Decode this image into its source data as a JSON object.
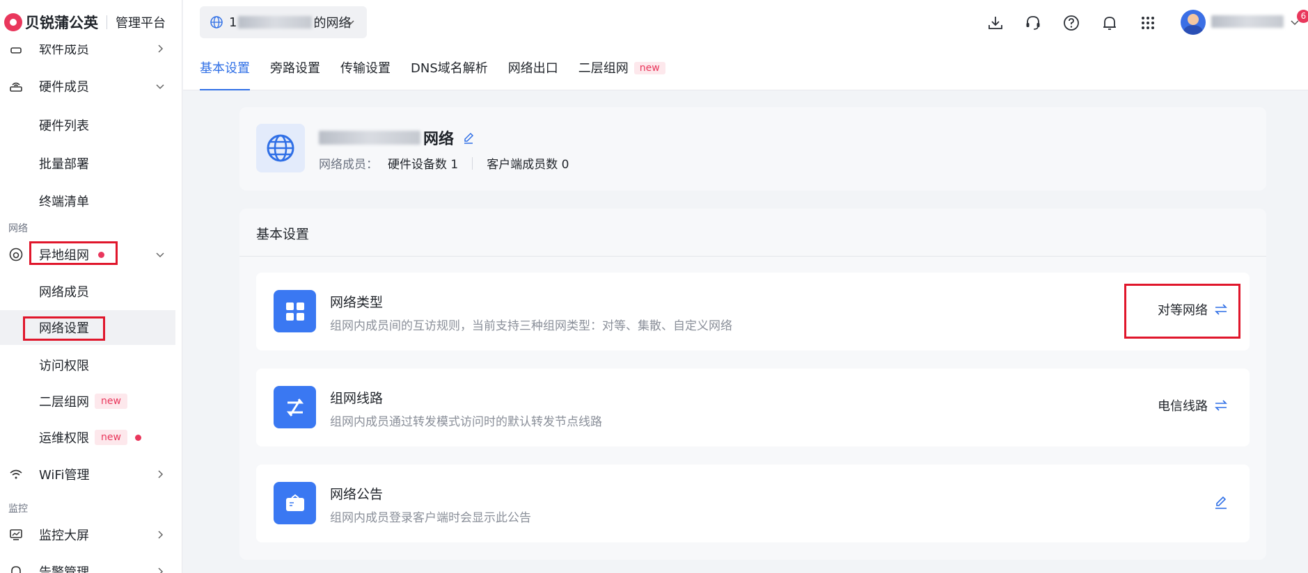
{
  "brand": {
    "name": "贝锐蒲公英",
    "subtitle": "管理平台"
  },
  "sidebar": {
    "items": [
      {
        "label": "软件成员",
        "icon": "device-icon"
      },
      {
        "label": "硬件成员",
        "icon": "router-icon"
      },
      {
        "label": "硬件列表"
      },
      {
        "label": "批量部署"
      },
      {
        "label": "终端清单"
      },
      {
        "label": "异地组网",
        "icon": "network-icon"
      },
      {
        "label": "网络成员"
      },
      {
        "label": "网络设置"
      },
      {
        "label": "访问权限"
      },
      {
        "label": "二层组网",
        "badge": "new"
      },
      {
        "label": "运维权限",
        "badge": "new"
      },
      {
        "label": "WiFi管理",
        "icon": "wifi-icon"
      },
      {
        "label": "监控大屏",
        "icon": "monitor-icon"
      },
      {
        "label": "告警管理",
        "icon": "bell-icon"
      }
    ],
    "sections": {
      "network": "网络",
      "monitor": "监控"
    }
  },
  "header": {
    "network_select": {
      "prefix": "1",
      "suffix": "的网络"
    },
    "notification_count": "6",
    "tabs": [
      {
        "label": "基本设置"
      },
      {
        "label": "旁路设置"
      },
      {
        "label": "传输设置"
      },
      {
        "label": "DNS域名解析"
      },
      {
        "label": "网络出口"
      },
      {
        "label": "二层组网",
        "badge": "new"
      }
    ]
  },
  "summary": {
    "title_suffix": "网络",
    "members_label": "网络成员：",
    "hardware_count": "硬件设备数 1",
    "client_count": "客户端成员数 0"
  },
  "settings": {
    "title": "基本设置",
    "rows": [
      {
        "title": "网络类型",
        "desc": "组网内成员间的互访规则，当前支持三种组网类型：对等、集散、自定义网络",
        "value": "对等网络"
      },
      {
        "title": "组网线路",
        "desc": "组网内成员通过转发模式访问时的默认转发节点线路",
        "value": "电信线路"
      },
      {
        "title": "网络公告",
        "desc": "组网内成员登录客户端时会显示此公告"
      }
    ]
  },
  "colors": {
    "accent": "#2f6fe6",
    "brand": "#e9375c",
    "highlight": "#e0162b"
  }
}
